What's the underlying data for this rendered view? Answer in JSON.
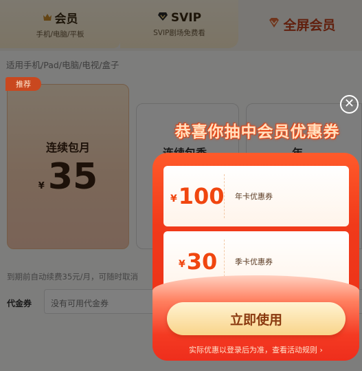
{
  "tabs": [
    {
      "title": "会员",
      "subtitle": "手机/电脑/平板"
    },
    {
      "title": "SVIP",
      "subtitle": "SVIP剧场免费看"
    },
    {
      "title": "全屏会员"
    }
  ],
  "device_line": "适用手机/Pad/电脑/电视/盒子",
  "recommend_tag": "推荐",
  "plans": [
    {
      "name": "连续包月",
      "currency": "¥",
      "price": "35"
    },
    {
      "name": "连续包季"
    },
    {
      "name": "年"
    }
  ],
  "auto_renew_note": "到期前自动续费35元/月，可随时取消",
  "voucher": {
    "label": "代金券",
    "value": "没有可用代金券"
  },
  "popup": {
    "close_symbol": "✕",
    "headline": "恭喜你抽中会员优惠券",
    "coupons": [
      {
        "currency": "¥",
        "amount": "100",
        "name": "年卡优惠券"
      },
      {
        "currency": "¥",
        "amount": "30",
        "name": "季卡优惠券"
      }
    ],
    "use_button": "立即使用",
    "rules_note": "实际优惠以登录后为准，查看活动规则 ›"
  },
  "colors": {
    "accent_red": "#f13a1a",
    "coupon_amount": "#f0460f",
    "button_gold": "#f9d48a"
  },
  "icons": [
    "vip-crown-icon",
    "svip-badge-icon",
    "full-screen-vip-icon",
    "close-icon"
  ]
}
